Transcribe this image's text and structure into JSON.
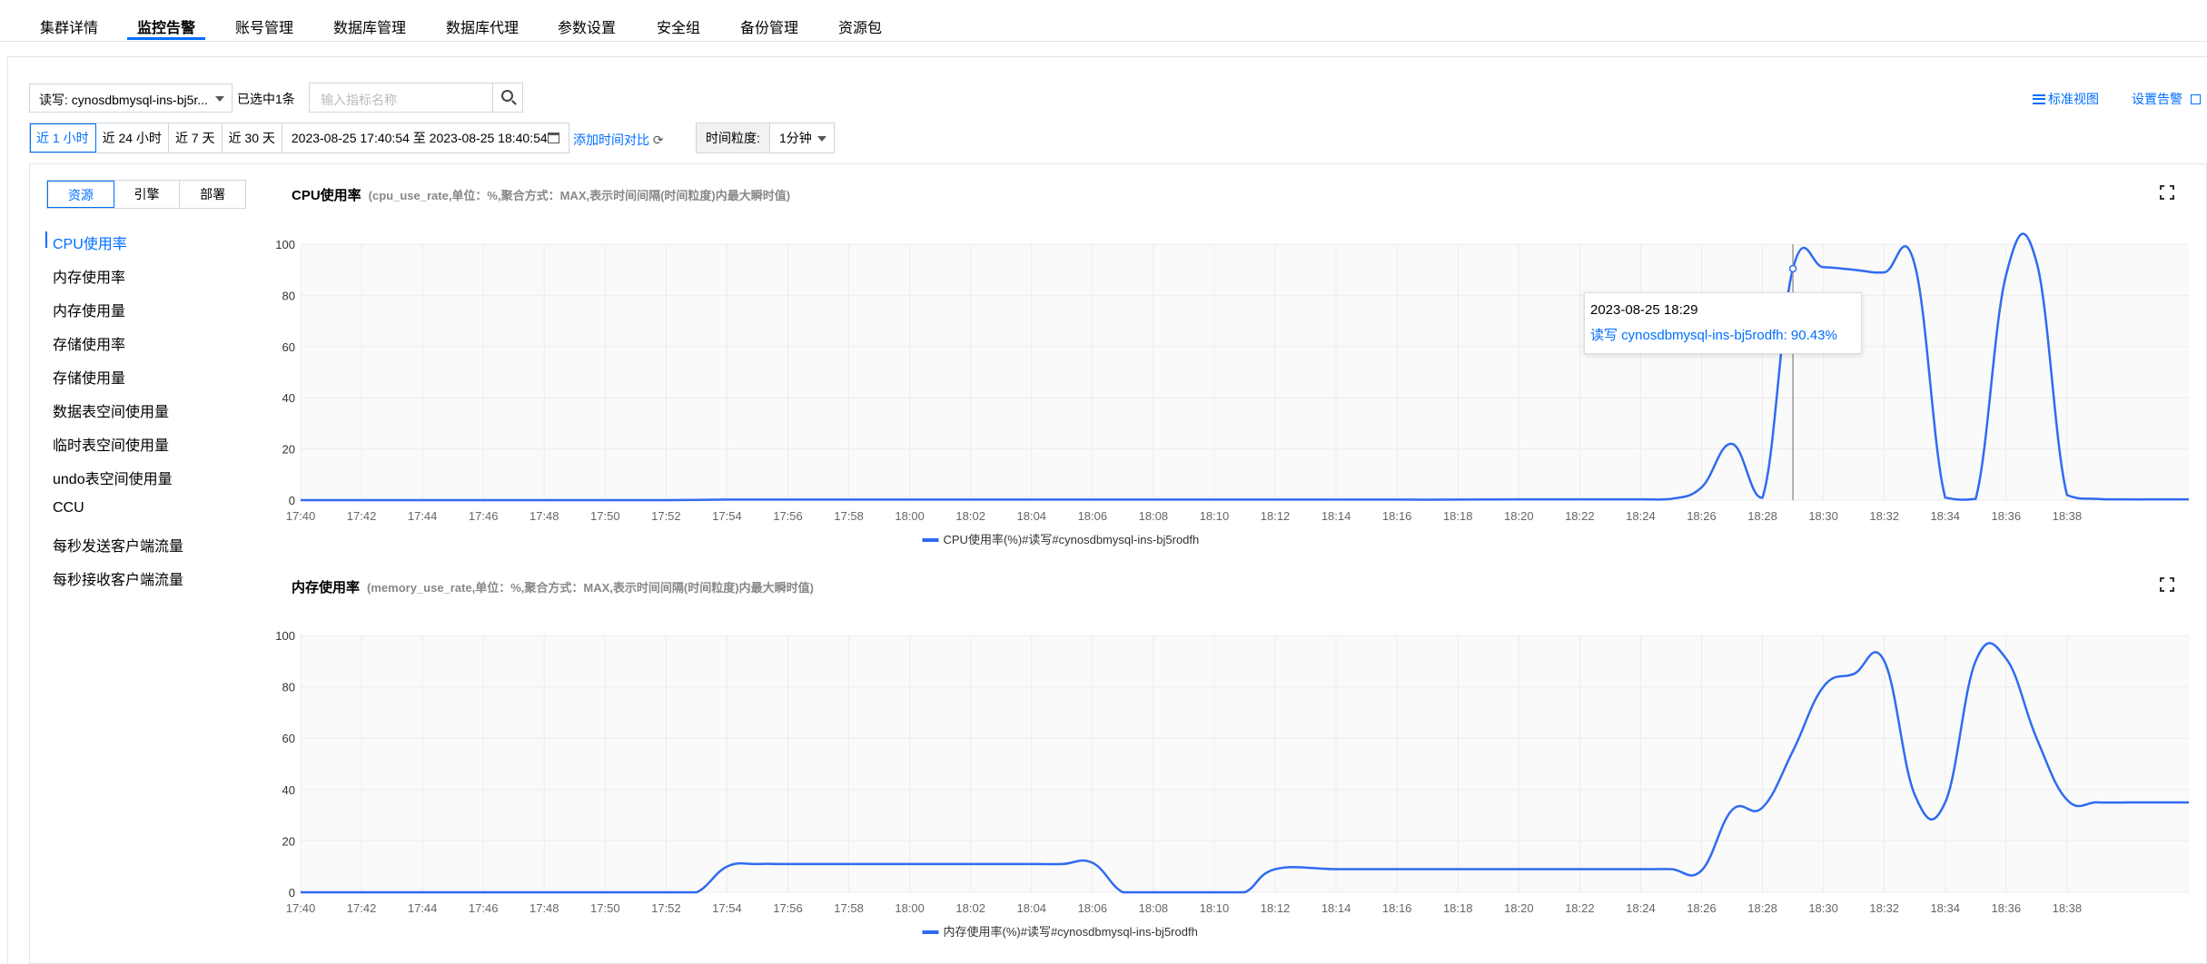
{
  "nav": {
    "tabs": [
      "集群详情",
      "监控告警",
      "账号管理",
      "数据库管理",
      "数据库代理",
      "参数设置",
      "安全组",
      "备份管理",
      "资源包"
    ],
    "active_index": 1
  },
  "toolbar": {
    "instance_select": "读写: cynosdbmysql-ins-bj5r...",
    "selected_count": "已选中1条",
    "search_placeholder": "输入指标名称",
    "standard_view": "标准视图",
    "set_alarm": "设置告警"
  },
  "time": {
    "ranges": [
      "近 1 小时",
      "近 24 小时",
      "近 7 天",
      "近 30 天"
    ],
    "active_range": 0,
    "date_range": "2023-08-25 17:40:54 至 2023-08-25 18:40:54",
    "compare": "添加时间对比",
    "granularity_label": "时间粒度:",
    "granularity_value": "1分钟"
  },
  "sidebar": {
    "segments": [
      "资源",
      "引擎",
      "部署"
    ],
    "active_segment": 0,
    "metrics": [
      "CPU使用率",
      "内存使用率",
      "内存使用量",
      "存储使用率",
      "存储使用量",
      "数据表空间使用量",
      "临时表空间使用量",
      "undo表空间使用量",
      "CCU",
      "每秒发送客户端流量",
      "每秒接收客户端流量"
    ],
    "active_metric": 0
  },
  "tooltip": {
    "time": "2023-08-25 18:29",
    "value": "读写 cynosdbmysql-ins-bj5rodfh: 90.43%"
  },
  "chart_data": [
    {
      "type": "line",
      "title": "CPU使用率",
      "subtitle": "(cpu_use_rate,单位：%,聚合方式：MAX,表示时间间隔(时间粒度)内最大瞬时值)",
      "x_ticks": [
        "17:40",
        "17:42",
        "17:44",
        "17:46",
        "17:48",
        "17:50",
        "17:52",
        "17:54",
        "17:56",
        "17:58",
        "18:00",
        "18:02",
        "18:04",
        "18:06",
        "18:08",
        "18:10",
        "18:12",
        "18:14",
        "18:16",
        "18:18",
        "18:20",
        "18:22",
        "18:24",
        "18:26",
        "18:28",
        "18:30",
        "18:32",
        "18:34",
        "18:36",
        "18:38"
      ],
      "y_ticks": [
        0,
        20,
        40,
        60,
        80,
        100
      ],
      "ylim": [
        0,
        100
      ],
      "legend": "CPU使用率(%)#读写#cynosdbmysql-ins-bj5rodfh",
      "color": "#2f6bf0",
      "series": [
        {
          "x": [
            0,
            2,
            4,
            6,
            8,
            10,
            12,
            14,
            16,
            18,
            20,
            22,
            24,
            26,
            28,
            30,
            32,
            34,
            36,
            38,
            40,
            42,
            44,
            45,
            46,
            47,
            48,
            49,
            50,
            51,
            52,
            53,
            54,
            55,
            56,
            57,
            58,
            59,
            60,
            61,
            62
          ],
          "values": [
            0,
            0,
            0,
            0,
            0,
            0,
            0,
            0.2,
            0.2,
            0.2,
            0.2,
            0.2,
            0.2,
            0.2,
            0.2,
            0.2,
            0.2,
            0.2,
            0.2,
            0.2,
            0.3,
            0.3,
            0.3,
            0.5,
            5,
            22,
            1,
            90.43,
            91,
            90,
            89,
            92,
            1,
            0.5,
            88,
            93,
            2,
            0.5,
            0.3,
            0.3,
            0.3
          ]
        }
      ],
      "crosshair_x": 49
    },
    {
      "type": "line",
      "title": "内存使用率",
      "subtitle": "(memory_use_rate,单位：%,聚合方式：MAX,表示时间间隔(时间粒度)内最大瞬时值)",
      "x_ticks": [
        "17:40",
        "17:42",
        "17:44",
        "17:46",
        "17:48",
        "17:50",
        "17:52",
        "17:54",
        "17:56",
        "17:58",
        "18:00",
        "18:02",
        "18:04",
        "18:06",
        "18:08",
        "18:10",
        "18:12",
        "18:14",
        "18:16",
        "18:18",
        "18:20",
        "18:22",
        "18:24",
        "18:26",
        "18:28",
        "18:30",
        "18:32",
        "18:34",
        "18:36",
        "18:38"
      ],
      "y_ticks": [
        0,
        20,
        40,
        60,
        80,
        100
      ],
      "ylim": [
        0,
        100
      ],
      "legend": "内存使用率(%)#读写#cynosdbmysql-ins-bj5rodfh",
      "color": "#2f6bf0",
      "series": [
        {
          "x": [
            0,
            2,
            4,
            6,
            8,
            10,
            12,
            13,
            14,
            15,
            16,
            18,
            20,
            22,
            24,
            25,
            26,
            27,
            28,
            30,
            31,
            32,
            34,
            36,
            38,
            40,
            42,
            44,
            45,
            46,
            47,
            48,
            49,
            50,
            51,
            52,
            53,
            54,
            55,
            56,
            57,
            58,
            59,
            60,
            61,
            62
          ],
          "values": [
            0,
            0,
            0,
            0,
            0,
            0,
            0,
            0,
            10,
            11,
            11,
            11,
            11,
            11,
            11,
            11,
            11.5,
            0,
            0,
            0,
            0,
            9,
            9,
            9,
            9,
            9,
            9,
            9,
            9,
            8.5,
            32,
            33,
            55,
            80,
            85,
            90,
            38,
            35,
            90,
            91,
            60,
            36,
            35,
            35,
            35,
            35
          ]
        }
      ]
    }
  ]
}
